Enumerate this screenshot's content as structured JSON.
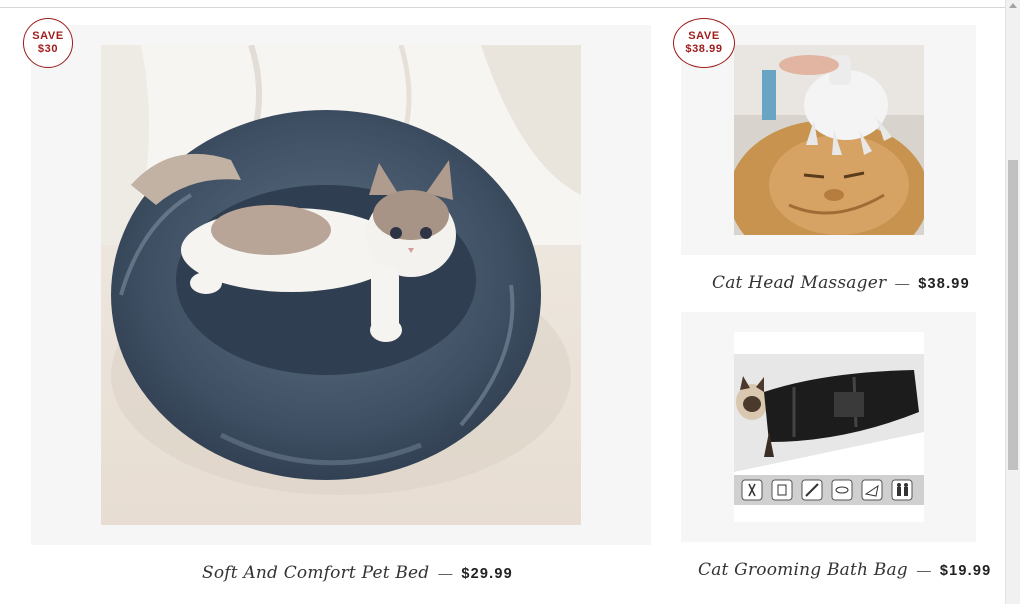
{
  "products": [
    {
      "title": "Soft And Comfort Pet Bed",
      "dash": "—",
      "price": "$29.99",
      "badge": {
        "label": "SAVE",
        "amount": "$30"
      },
      "image_icon": "cat-bed-photo"
    },
    {
      "title": "Cat Head Massager",
      "dash": "—",
      "price": "$38.99",
      "badge": {
        "label": "SAVE",
        "amount": "$38.99"
      },
      "image_icon": "cat-massager-photo"
    },
    {
      "title": "Cat Grooming Bath Bag",
      "dash": "—",
      "price": "$19.99",
      "badge": null,
      "image_icon": "cat-bath-bag-photo"
    }
  ],
  "colors": {
    "badge": "#9e1b1b",
    "card_bg": "#f6f6f6",
    "text": "#333333"
  }
}
